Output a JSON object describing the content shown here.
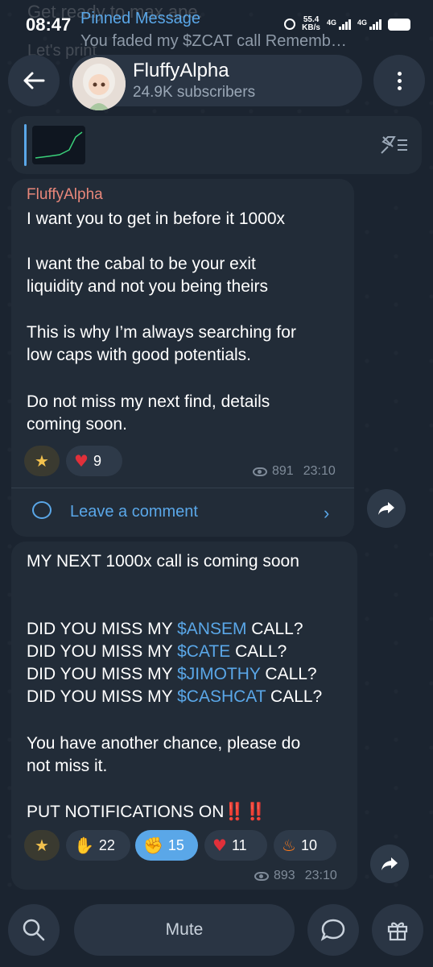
{
  "status_bar": {
    "time": "08:47",
    "speed_value": "55.4",
    "speed_unit": "KB/s",
    "sig1": "4G",
    "sig2": "4G"
  },
  "ghost_lines": [
    "Get ready to max ape.",
    "Let's print"
  ],
  "header": {
    "channel_name": "FluffyAlpha",
    "subscribers": "24.9K subscribers"
  },
  "pinned": {
    "title": "Pinned Message",
    "text": "You faded my $ZCAT call  Rememb…"
  },
  "post1": {
    "sender": "FluffyAlpha",
    "lines": [
      "I want you to get in before it 1000x",
      "I want the cabal to be your exit",
      "liquidity and not you being theirs",
      "This is why I’m always searching for",
      "low caps with good potentials.",
      "Do not miss my next find, details",
      "coming soon."
    ],
    "reactions": {
      "heart": "9"
    },
    "views": "891",
    "time": "23:10",
    "comment_label": "Leave a comment"
  },
  "post2": {
    "line1": "MY NEXT 1000x call is coming soon",
    "miss_prefix": "DID YOU MISS MY ",
    "miss_suffix": " CALL?",
    "tickers": [
      "$ANSEM",
      "$CATE",
      "$JIMOTHY",
      "$CASHCAT"
    ],
    "chance1": "You have another chance, please do",
    "chance2": "not miss it.",
    "notif": "PUT NOTIFICATIONS ON",
    "notif_marks": "‼️‼️",
    "reactions": {
      "clap": "22",
      "thumb": "15",
      "heart": "11",
      "fire": "10"
    },
    "views": "893",
    "time": "23:10"
  },
  "bottom": {
    "mute_label": "Mute"
  },
  "colors": {
    "accent": "#5aa7e8",
    "bubble": "#222c38",
    "background": "#1b2430",
    "sender": "#e8877a"
  },
  "icons": [
    "back-arrow-icon",
    "more-vert-icon",
    "unpin-icon",
    "star-reaction-icon",
    "heart-icon",
    "eye-icon",
    "comment-icon",
    "chevron-right-icon",
    "share-icon",
    "clap-icon",
    "thumbs-up-icon",
    "fire-icon",
    "search-icon",
    "chat-icon",
    "gift-icon"
  ]
}
